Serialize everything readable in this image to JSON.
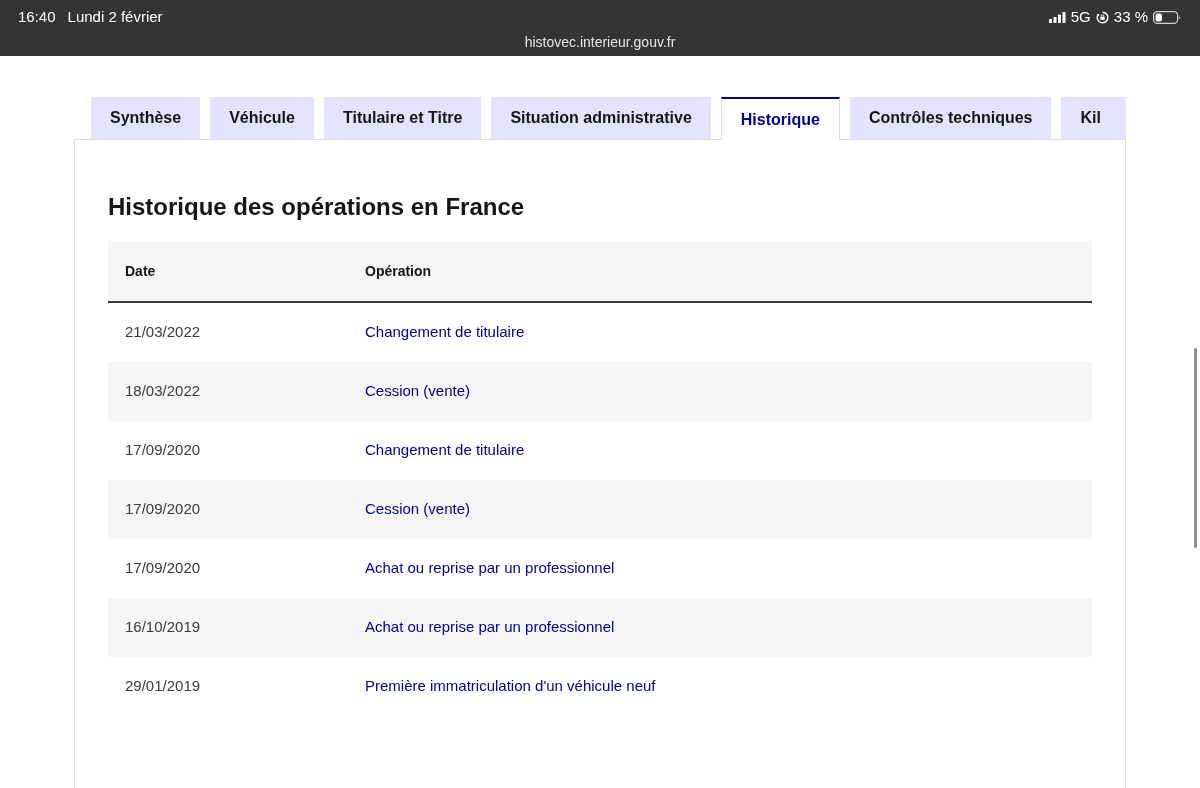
{
  "status_bar": {
    "time": "16:40",
    "date": "Lundi 2 février",
    "url": "histovec.interieur.gouv.fr",
    "network": "5G",
    "battery": "33 %"
  },
  "tabs": [
    {
      "label": "Synthèse",
      "selected": false
    },
    {
      "label": "Véhicule",
      "selected": false
    },
    {
      "label": "Titulaire et Titre",
      "selected": false
    },
    {
      "label": "Situation administrative",
      "selected": false
    },
    {
      "label": "Historique",
      "selected": true
    },
    {
      "label": "Contrôles techniques",
      "selected": false
    },
    {
      "label": "Kil",
      "selected": false
    }
  ],
  "section": {
    "title": "Historique des opérations en France",
    "table": {
      "columns": [
        "Date",
        "Opération"
      ],
      "rows": [
        {
          "date": "21/03/2022",
          "operation": "Changement de titulaire"
        },
        {
          "date": "18/03/2022",
          "operation": "Cession (vente)"
        },
        {
          "date": "17/09/2020",
          "operation": "Changement de titulaire"
        },
        {
          "date": "17/09/2020",
          "operation": "Cession (vente)"
        },
        {
          "date": "17/09/2020",
          "operation": "Achat ou reprise par un professionnel"
        },
        {
          "date": "16/10/2019",
          "operation": "Achat ou reprise par un professionnel"
        },
        {
          "date": "29/01/2019",
          "operation": "Première immatriculation d'un véhicule neuf"
        }
      ]
    }
  }
}
